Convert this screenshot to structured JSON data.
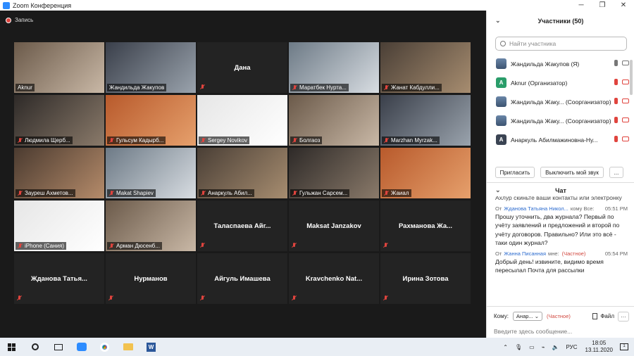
{
  "window": {
    "title": "Zoom Конференция"
  },
  "recording": {
    "label": "Запись"
  },
  "tiles": [
    {
      "name": "Aknur",
      "kind": "video",
      "muted": false,
      "active": true
    },
    {
      "name": "Жандильда Жакупов",
      "kind": "video",
      "muted": false
    },
    {
      "name": "Дана",
      "kind": "name",
      "muted": true
    },
    {
      "name": "Маратбек Нурта...",
      "kind": "video",
      "muted": true
    },
    {
      "name": "Жанат Кабдулли...",
      "kind": "video",
      "muted": true
    },
    {
      "name": "Людмила Щерб...",
      "kind": "video",
      "muted": true
    },
    {
      "name": "Гульсум Кадырб...",
      "kind": "video",
      "muted": true
    },
    {
      "name": "Sergey Novikov",
      "kind": "video",
      "muted": true
    },
    {
      "name": "Болгаоз",
      "kind": "video",
      "muted": true
    },
    {
      "name": "Marzhan Myrzak...",
      "kind": "video",
      "muted": true
    },
    {
      "name": "Зауреш Ахметов...",
      "kind": "video",
      "muted": true
    },
    {
      "name": "Makat Shapiev",
      "kind": "video",
      "muted": true
    },
    {
      "name": "Анаркуль Абил...",
      "kind": "video",
      "muted": true
    },
    {
      "name": "Гульжан Сарсем...",
      "kind": "video",
      "muted": true
    },
    {
      "name": "Жаиал",
      "kind": "video",
      "muted": true
    },
    {
      "name": "iPhone (Сания)",
      "kind": "video",
      "muted": true
    },
    {
      "name": "Арман Дюсенб...",
      "kind": "video",
      "muted": true
    },
    {
      "name": "Таласпаева Айг...",
      "kind": "name",
      "muted": true
    },
    {
      "name": "Maksat Janzakov",
      "kind": "name",
      "muted": true
    },
    {
      "name": "Рахманова Жа...",
      "kind": "name",
      "muted": true
    },
    {
      "name": "Жданова Татья...",
      "kind": "name",
      "muted": true
    },
    {
      "name": "Нурманов",
      "kind": "name",
      "muted": true
    },
    {
      "name": "Айгуль Имашева",
      "kind": "name",
      "muted": true
    },
    {
      "name": "Kravchenko Nat...",
      "kind": "name",
      "muted": true
    },
    {
      "name": "Ирина Зотова",
      "kind": "name",
      "muted": true
    }
  ],
  "participants": {
    "title": "Участники (50)",
    "search_placeholder": "Найти участника",
    "list": [
      {
        "name": "Жандильда Жакупов (Я)",
        "avatar": "photo",
        "initial": ""
      },
      {
        "name": "Aknur (Организатор)",
        "avatar": "green",
        "initial": "A"
      },
      {
        "name": "Жандильда Жаку... (Соорганизатор)",
        "avatar": "photo",
        "initial": ""
      },
      {
        "name": "Жандильда Жаку... (Соорганизатор)",
        "avatar": "photo",
        "initial": ""
      },
      {
        "name": "Анаркуль Абилмажиновна-Ну...",
        "avatar": "dark",
        "initial": "A"
      }
    ],
    "invite_label": "Пригласить",
    "mute_all_label": "Выключить мой звук",
    "more_label": "..."
  },
  "chat": {
    "title": "Чат",
    "prev_text": "Ахлур скиньте ваши контакты или электронку",
    "messages": [
      {
        "from_prefix": "От",
        "from": "Жданова Татьяна Никол...",
        "to": "кому Все:",
        "time": "05:51 PM",
        "private": "",
        "text": "Прошу уточнить, два журнала? Первый по учёту заявлений и предложений и второй по учёту договоров. Правильно? Или это всё - таки один журнал?"
      },
      {
        "from_prefix": "От",
        "from": "Жанна Писанная",
        "to": "мне:",
        "time": "05:54 PM",
        "private": "(Частное)",
        "text": "Добрый день! извините, видимо время пересылал Почта для рассылки"
      }
    ],
    "to_label": "Кому:",
    "to_value": "Анар...",
    "to_private": "(Частное)",
    "file_label": "Файл",
    "input_placeholder": "Введите здесь сообщение..."
  },
  "taskbar": {
    "lang": "РУС",
    "time": "18:05",
    "date": "13.11.2020",
    "notif_count": "1"
  }
}
